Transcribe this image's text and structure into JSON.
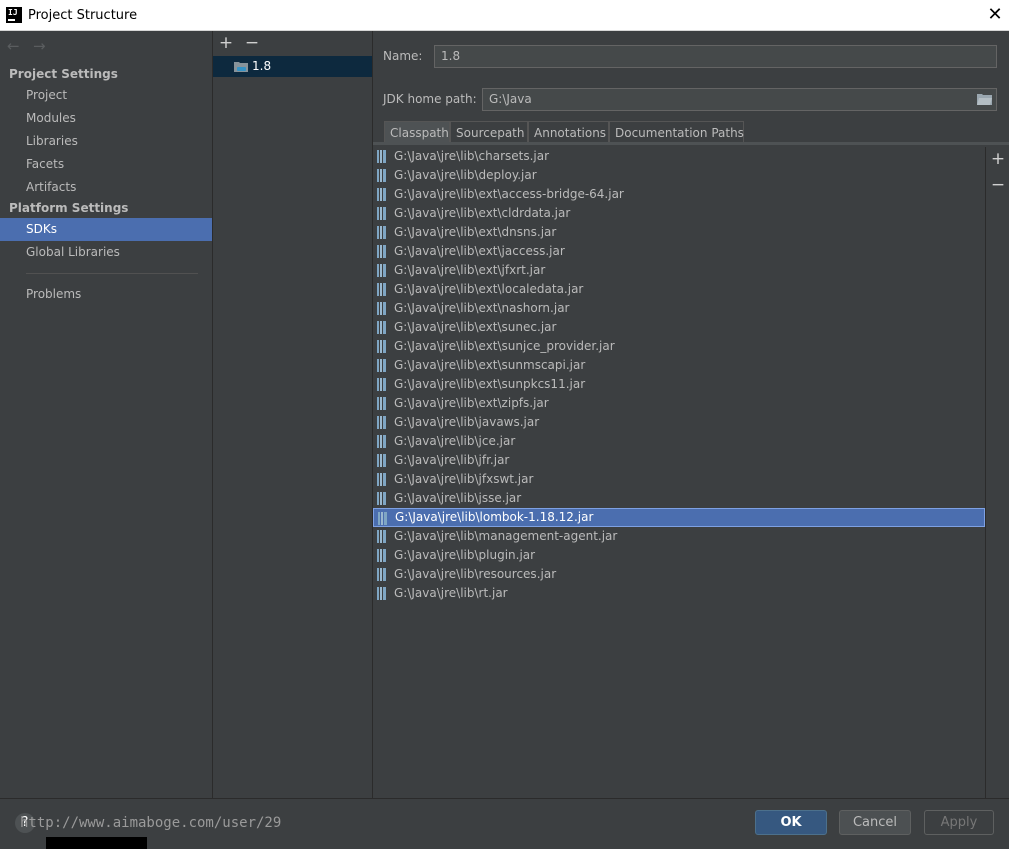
{
  "window": {
    "title": "Project Structure",
    "close_glyph": "✕",
    "app_icon": "IJ"
  },
  "navigation": {
    "back_glyph": "←",
    "forward_glyph": "→",
    "project_settings_title": "Project Settings",
    "project_settings_items": [
      "Project",
      "Modules",
      "Libraries",
      "Facets",
      "Artifacts"
    ],
    "platform_settings_title": "Platform Settings",
    "platform_settings_items": [
      "SDKs",
      "Global Libraries"
    ],
    "selected_item": "SDKs",
    "problems_label": "Problems"
  },
  "sdk_list": {
    "add_glyph": "+",
    "remove_glyph": "−",
    "items": [
      "1.8"
    ],
    "selected": "1.8"
  },
  "detail": {
    "name_label": "Name:",
    "name_value": "1.8",
    "jdk_home_label": "JDK home path:",
    "jdk_home_value": "G:\\Java",
    "tabs": [
      "Classpath",
      "Sourcepath",
      "Annotations",
      "Documentation Paths"
    ],
    "active_tab": "Classpath",
    "classpath": [
      "G:\\Java\\jre\\lib\\charsets.jar",
      "G:\\Java\\jre\\lib\\deploy.jar",
      "G:\\Java\\jre\\lib\\ext\\access-bridge-64.jar",
      "G:\\Java\\jre\\lib\\ext\\cldrdata.jar",
      "G:\\Java\\jre\\lib\\ext\\dnsns.jar",
      "G:\\Java\\jre\\lib\\ext\\jaccess.jar",
      "G:\\Java\\jre\\lib\\ext\\jfxrt.jar",
      "G:\\Java\\jre\\lib\\ext\\localedata.jar",
      "G:\\Java\\jre\\lib\\ext\\nashorn.jar",
      "G:\\Java\\jre\\lib\\ext\\sunec.jar",
      "G:\\Java\\jre\\lib\\ext\\sunjce_provider.jar",
      "G:\\Java\\jre\\lib\\ext\\sunmscapi.jar",
      "G:\\Java\\jre\\lib\\ext\\sunpkcs11.jar",
      "G:\\Java\\jre\\lib\\ext\\zipfs.jar",
      "G:\\Java\\jre\\lib\\javaws.jar",
      "G:\\Java\\jre\\lib\\jce.jar",
      "G:\\Java\\jre\\lib\\jfr.jar",
      "G:\\Java\\jre\\lib\\jfxswt.jar",
      "G:\\Java\\jre\\lib\\jsse.jar",
      "G:\\Java\\jre\\lib\\lombok-1.18.12.jar",
      "G:\\Java\\jre\\lib\\management-agent.jar",
      "G:\\Java\\jre\\lib\\plugin.jar",
      "G:\\Java\\jre\\lib\\resources.jar",
      "G:\\Java\\jre\\lib\\rt.jar"
    ],
    "selected_classpath": "G:\\Java\\jre\\lib\\lombok-1.18.12.jar",
    "add_glyph": "+",
    "remove_glyph": "−"
  },
  "footer": {
    "help_glyph": "?",
    "watermark": "http://www.aimaboge.com/user/29",
    "ok_label": "OK",
    "cancel_label": "Cancel",
    "apply_label": "Apply"
  },
  "colors": {
    "background": "#3c3f41",
    "selection": "#4b6eaf",
    "sdk_selection": "#0d293e",
    "primary_button": "#365880"
  }
}
